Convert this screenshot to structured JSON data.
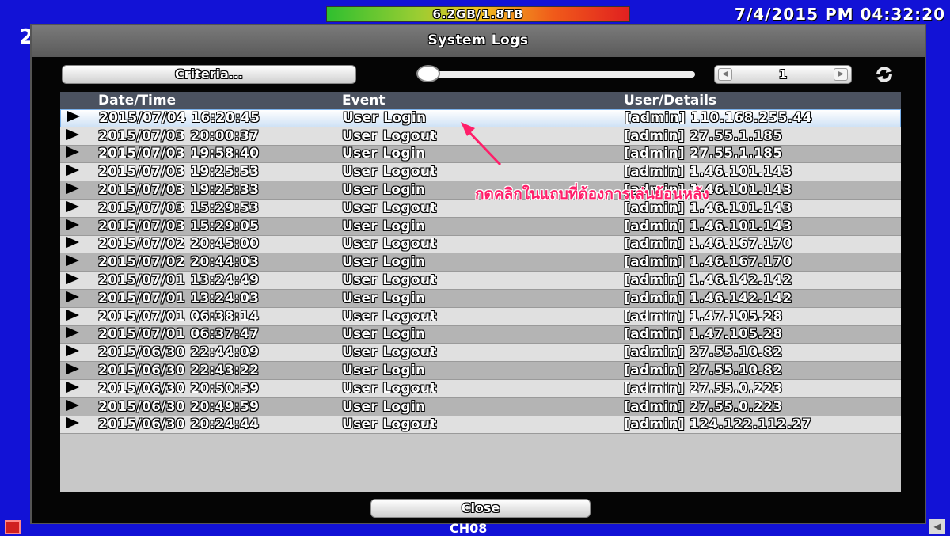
{
  "topbar": {
    "storage": "6.2GB/1.8TB",
    "datetime": "7/4/2015 PM 04:32:20",
    "bg_digit": "2"
  },
  "dialog": {
    "title": "System Logs",
    "criteria_label": "Criteria...",
    "page_number": "1",
    "close_label": "Close",
    "columns": {
      "date": "Date/Time",
      "event": "Event",
      "user": "User/Details"
    },
    "rows": [
      {
        "date": "2015/07/04 16:20:45",
        "event": "User Login",
        "user": "[admin] 110.168.255.44"
      },
      {
        "date": "2015/07/03 20:00:37",
        "event": "User Logout",
        "user": "[admin] 27.55.1.185"
      },
      {
        "date": "2015/07/03 19:58:40",
        "event": "User Login",
        "user": "[admin] 27.55.1.185"
      },
      {
        "date": "2015/07/03 19:25:53",
        "event": "User Logout",
        "user": "[admin] 1.46.101.143"
      },
      {
        "date": "2015/07/03 19:25:33",
        "event": "User Login",
        "user": "[admin] 1.46.101.143"
      },
      {
        "date": "2015/07/03 15:29:53",
        "event": "User Logout",
        "user": "[admin] 1.46.101.143"
      },
      {
        "date": "2015/07/03 15:29:05",
        "event": "User Login",
        "user": "[admin] 1.46.101.143"
      },
      {
        "date": "2015/07/02 20:45:00",
        "event": "User Logout",
        "user": "[admin] 1.46.167.170"
      },
      {
        "date": "2015/07/02 20:44:03",
        "event": "User Login",
        "user": "[admin] 1.46.167.170"
      },
      {
        "date": "2015/07/01 13:24:49",
        "event": "User Logout",
        "user": "[admin] 1.46.142.142"
      },
      {
        "date": "2015/07/01 13:24:03",
        "event": "User Login",
        "user": "[admin] 1.46.142.142"
      },
      {
        "date": "2015/07/01 06:38:14",
        "event": "User Logout",
        "user": "[admin] 1.47.105.28"
      },
      {
        "date": "2015/07/01 06:37:47",
        "event": "User Login",
        "user": "[admin] 1.47.105.28"
      },
      {
        "date": "2015/06/30 22:44:09",
        "event": "User Logout",
        "user": "[admin] 27.55.10.82"
      },
      {
        "date": "2015/06/30 22:43:22",
        "event": "User Login",
        "user": "[admin] 27.55.10.82"
      },
      {
        "date": "2015/06/30 20:50:59",
        "event": "User Logout",
        "user": "[admin] 27.55.0.223"
      },
      {
        "date": "2015/06/30 20:49:59",
        "event": "User Login",
        "user": "[admin] 27.55.0.223"
      },
      {
        "date": "2015/06/30 20:24:44",
        "event": "User Logout",
        "user": "[admin] 124.122.112.27"
      }
    ]
  },
  "channel": "CH08",
  "annotation": "กดคลิกในแถบที่ต้องการเล่นย้อนหลัง",
  "colors": {
    "background": "#1212d6",
    "accent": "#ff1f6a"
  }
}
